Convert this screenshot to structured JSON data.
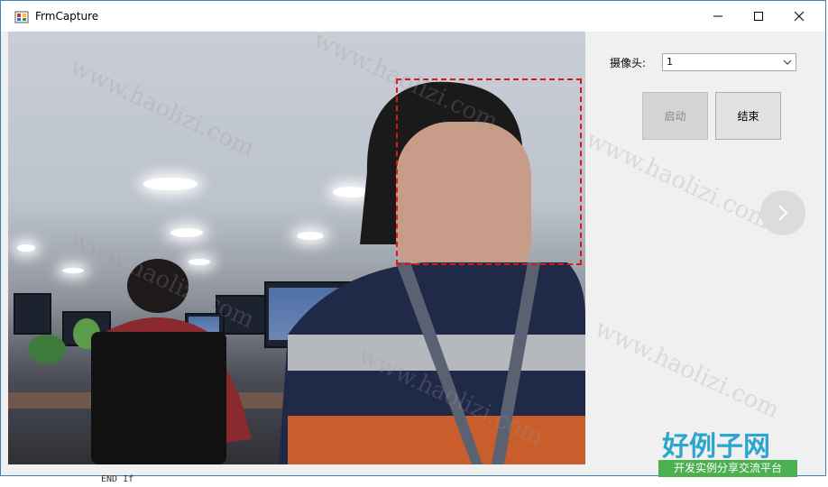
{
  "window": {
    "title": "FrmCapture",
    "controls": {
      "minimize": "minimize",
      "maximize": "maximize",
      "close": "close"
    }
  },
  "camera": {
    "label": "摄像头:",
    "selected": "1"
  },
  "buttons": {
    "start_label": "启动",
    "stop_label": "结束"
  },
  "watermarks": [
    "www.haolizi.com",
    "www.haolizi.com",
    "www.haolizi.com",
    "www.haolizi.com",
    "www.haolizi.com",
    "www.haolizi.com"
  ],
  "logo": {
    "main": "好例子网",
    "sub": "开发实例分享交流平台"
  },
  "background_text": "END If"
}
